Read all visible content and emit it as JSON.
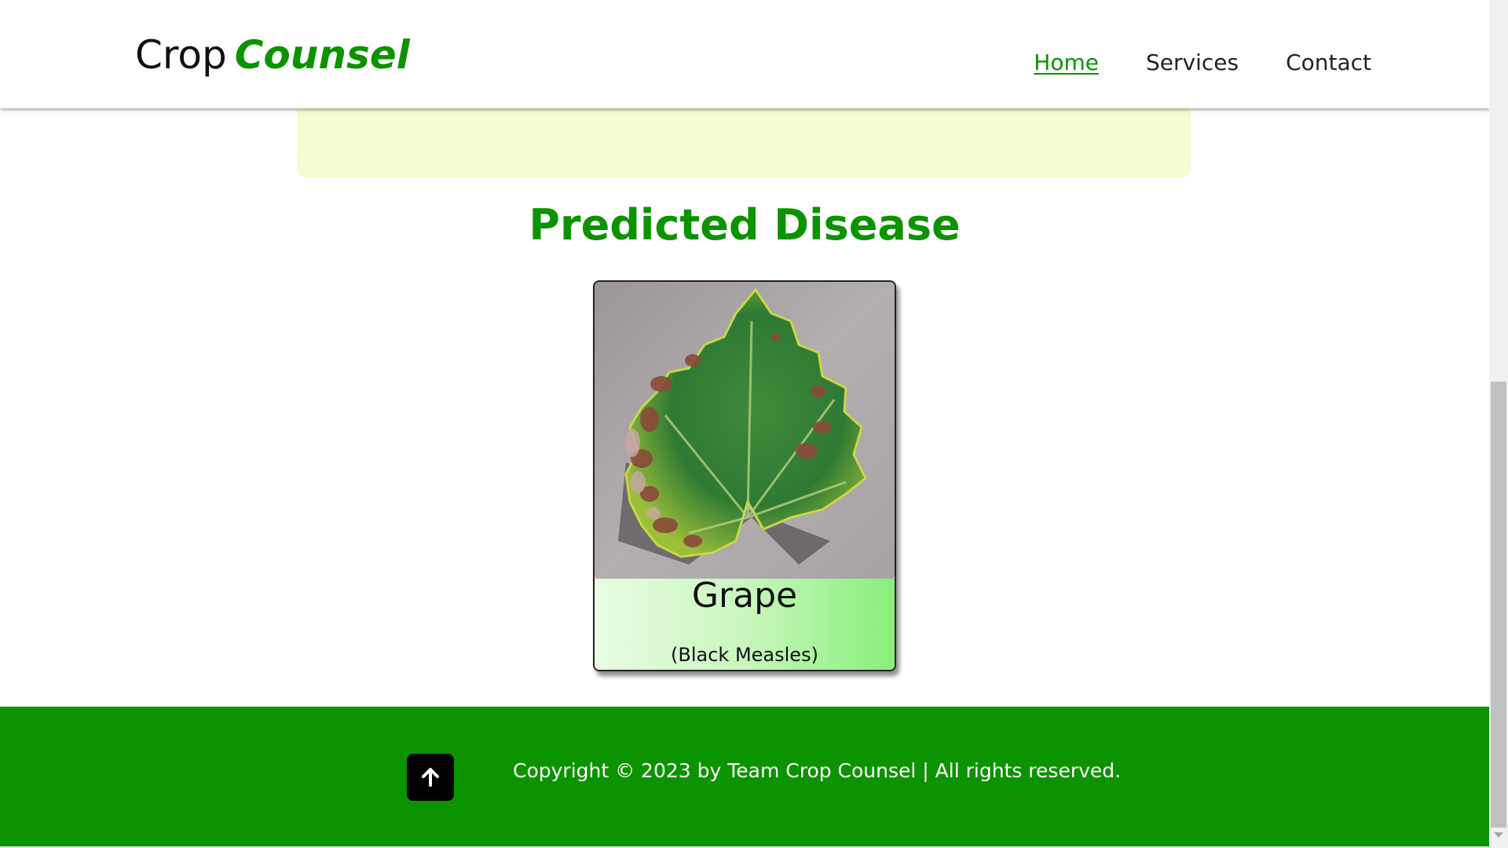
{
  "header": {
    "logo_primary": "Crop",
    "logo_accent": "Counsel",
    "nav": [
      {
        "label": "Home",
        "active": true
      },
      {
        "label": "Services",
        "active": false
      },
      {
        "label": "Contact",
        "active": false
      }
    ]
  },
  "main": {
    "section_title": "Predicted Disease",
    "card": {
      "image_icon": "grape-leaf-image",
      "title": "Grape",
      "subtitle": "(Black Measles)"
    }
  },
  "footer": {
    "back_to_top_icon": "arrow-up-icon",
    "copyright": "Copyright © 2023 by Team Crop Counsel | All rights reserved."
  },
  "colors": {
    "brand_green": "#0c9300",
    "panel_bg": "#f3fdd0",
    "footer_bg": "#0c9300"
  }
}
